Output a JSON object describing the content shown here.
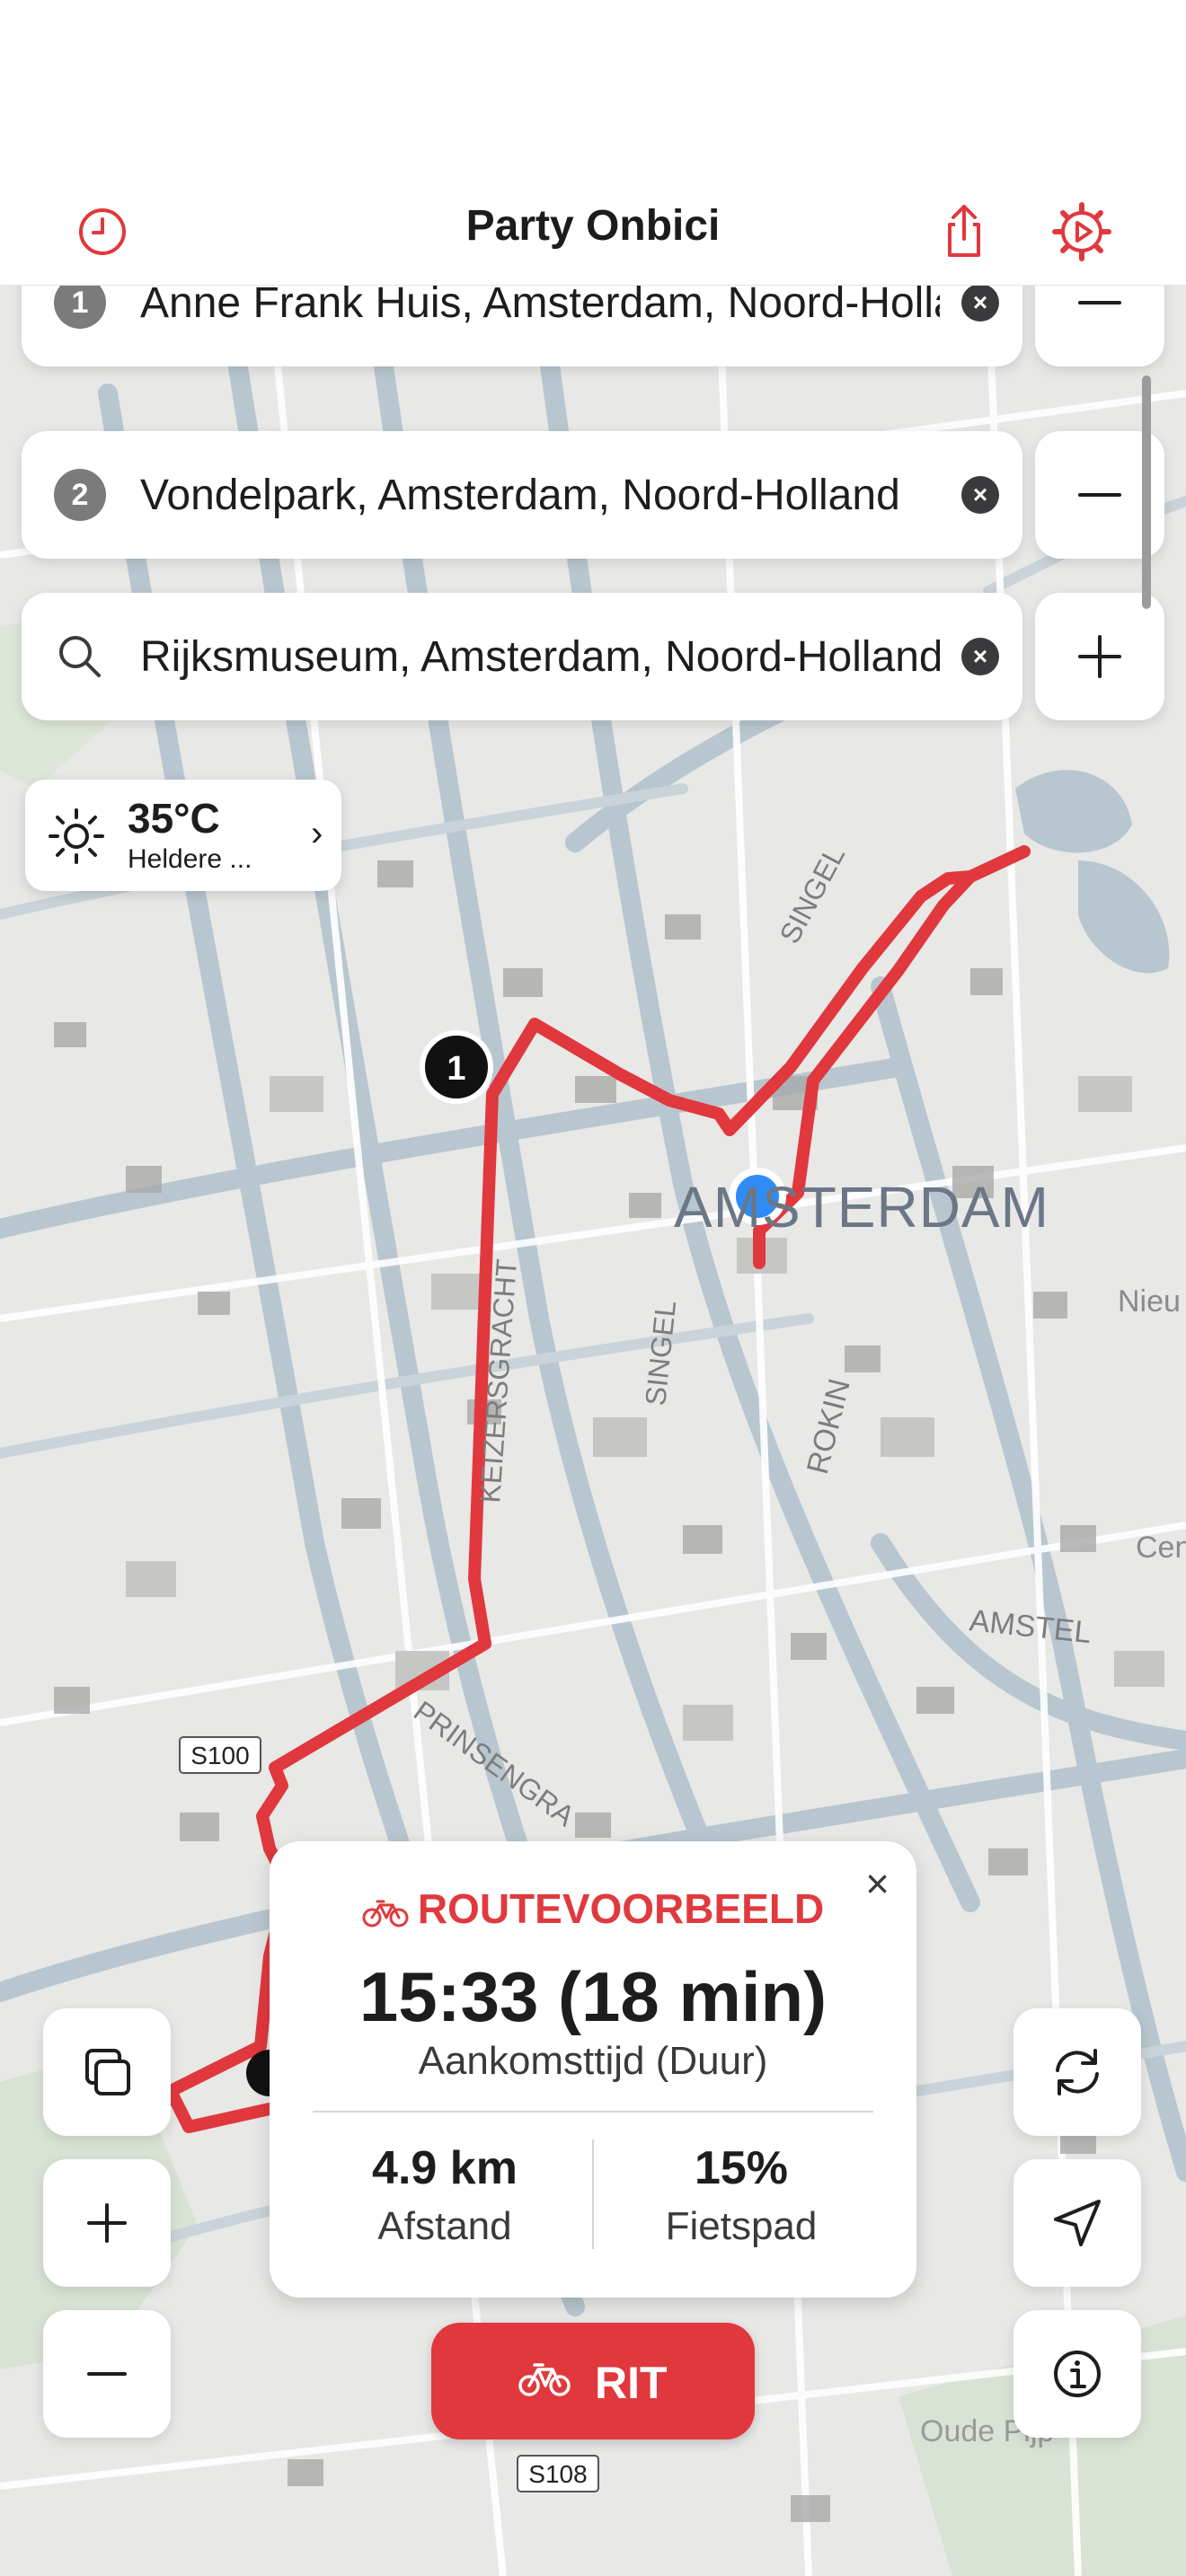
{
  "header": {
    "title": "Party Onbici",
    "accent_color": "#e0383d",
    "icons": {
      "history": "clock-icon",
      "share": "share-icon",
      "settings": "gear-play-icon"
    }
  },
  "waypoints": [
    {
      "number": "1",
      "value": "Anne Frank Huis, Amsterdam, Noord-Holland",
      "action": "minus"
    },
    {
      "number": "2",
      "value": "Vondelpark, Amsterdam, Noord-Holland",
      "action": "minus"
    },
    {
      "icon": "search-icon",
      "value": "Rijksmuseum, Amsterdam, Noord-Holland",
      "action": "plus"
    }
  ],
  "weather": {
    "temperature": "35°C",
    "description": "Heldere ..."
  },
  "map": {
    "labels": {
      "city": "AMSTERDAM",
      "singel_north": "SINGEL",
      "singel_south": "SINGEL",
      "keizersgracht": "KEIZERSGRACHT",
      "rokin": "ROKIN",
      "amstel": "AMSTEL",
      "prinsengracht": "PRINSENGRA",
      "nieuw": "Nieu",
      "cen": "Cen",
      "oude": "Oude Pijp",
      "route_s100": "S100",
      "route_s108": "S108"
    },
    "marker_label": "1",
    "route_color": "#e0383d",
    "location_color": "#2f8cf5"
  },
  "route_card": {
    "heading": "ROUTEVOORBEELD",
    "arrival": "15:33 (18 min)",
    "arrival_label": "Aankomsttijd (Duur)",
    "distance": "4.9 km",
    "distance_label": "Afstand",
    "bikepath": "15%",
    "bikepath_label": "Fietspad",
    "close": "×"
  },
  "controls": {
    "layers": "layers-icon",
    "zoom_in": "plus-icon",
    "zoom_out": "minus-icon",
    "refresh": "refresh-icon",
    "locate": "navigation-arrow-icon",
    "info": "info-icon"
  },
  "ride_button": {
    "label": "RIT"
  }
}
